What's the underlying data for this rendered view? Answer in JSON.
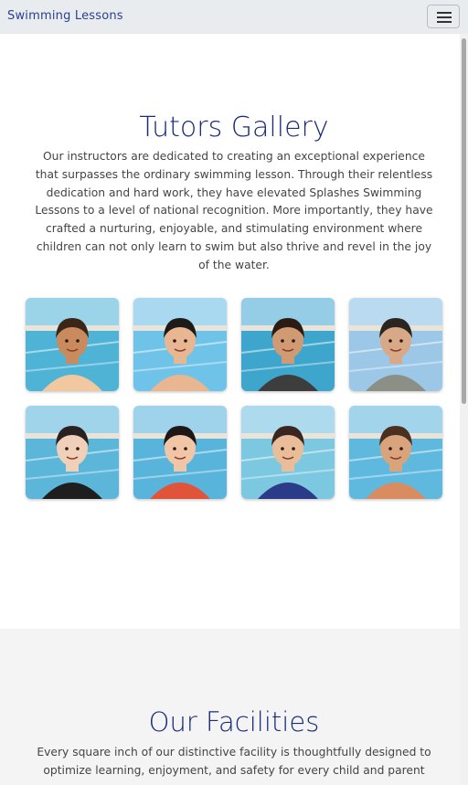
{
  "navbar": {
    "brand": "Swimming Lessons",
    "menu_icon": "hamburger-menu-icon"
  },
  "gallery": {
    "title": "Tutors Gallery",
    "description": "Our instructors are dedicated to creating an exceptional experience that surpasses the ordinary swimming lesson. Through their relentless dedication and hard work, they have elevated Splashes Swimming Lessons to a level of national recognition. More importantly, they have crafted a nurturing, enjoyable, and stimulating environment where children can not only learn to swim but also thrive and revel in the joy of the water.",
    "tutors": [
      {
        "skin": "#c98a5e",
        "hair": "#3b2418",
        "shirt": "#f2c8a0",
        "bg": "#4fb3d6"
      },
      {
        "skin": "#e8b690",
        "hair": "#1e1a1a",
        "shirt": "#e8b690",
        "bg": "#6fc3e8"
      },
      {
        "skin": "#d09a72",
        "hair": "#2a1c14",
        "shirt": "#3d3d3d",
        "bg": "#3ea6cc"
      },
      {
        "skin": "#d8a987",
        "hair": "#2b2521",
        "shirt": "#8c8f86",
        "bg": "#9cc7e6"
      },
      {
        "skin": "#f0d0b8",
        "hair": "#2a2220",
        "shirt": "#1e1e1e",
        "bg": "#5bb6da"
      },
      {
        "skin": "#f1c6a6",
        "hair": "#1f1715",
        "shirt": "#e0553a",
        "bg": "#59b4dc"
      },
      {
        "skin": "#e9bd9a",
        "hair": "#3a2620",
        "shirt": "#2c3a8a",
        "bg": "#7cc8e0"
      },
      {
        "skin": "#d9a47c",
        "hair": "#4a3020",
        "shirt": "#d98c5f",
        "bg": "#5fb8de"
      }
    ]
  },
  "facilities": {
    "title": "Our Facilities",
    "description": "Every square inch of our distinctive facility is thoughtfully designed to optimize learning, enjoyment, and safety for every child and parent"
  },
  "colors": {
    "accent": "#1a2b7a",
    "navbar_bg": "#e9ecef"
  }
}
